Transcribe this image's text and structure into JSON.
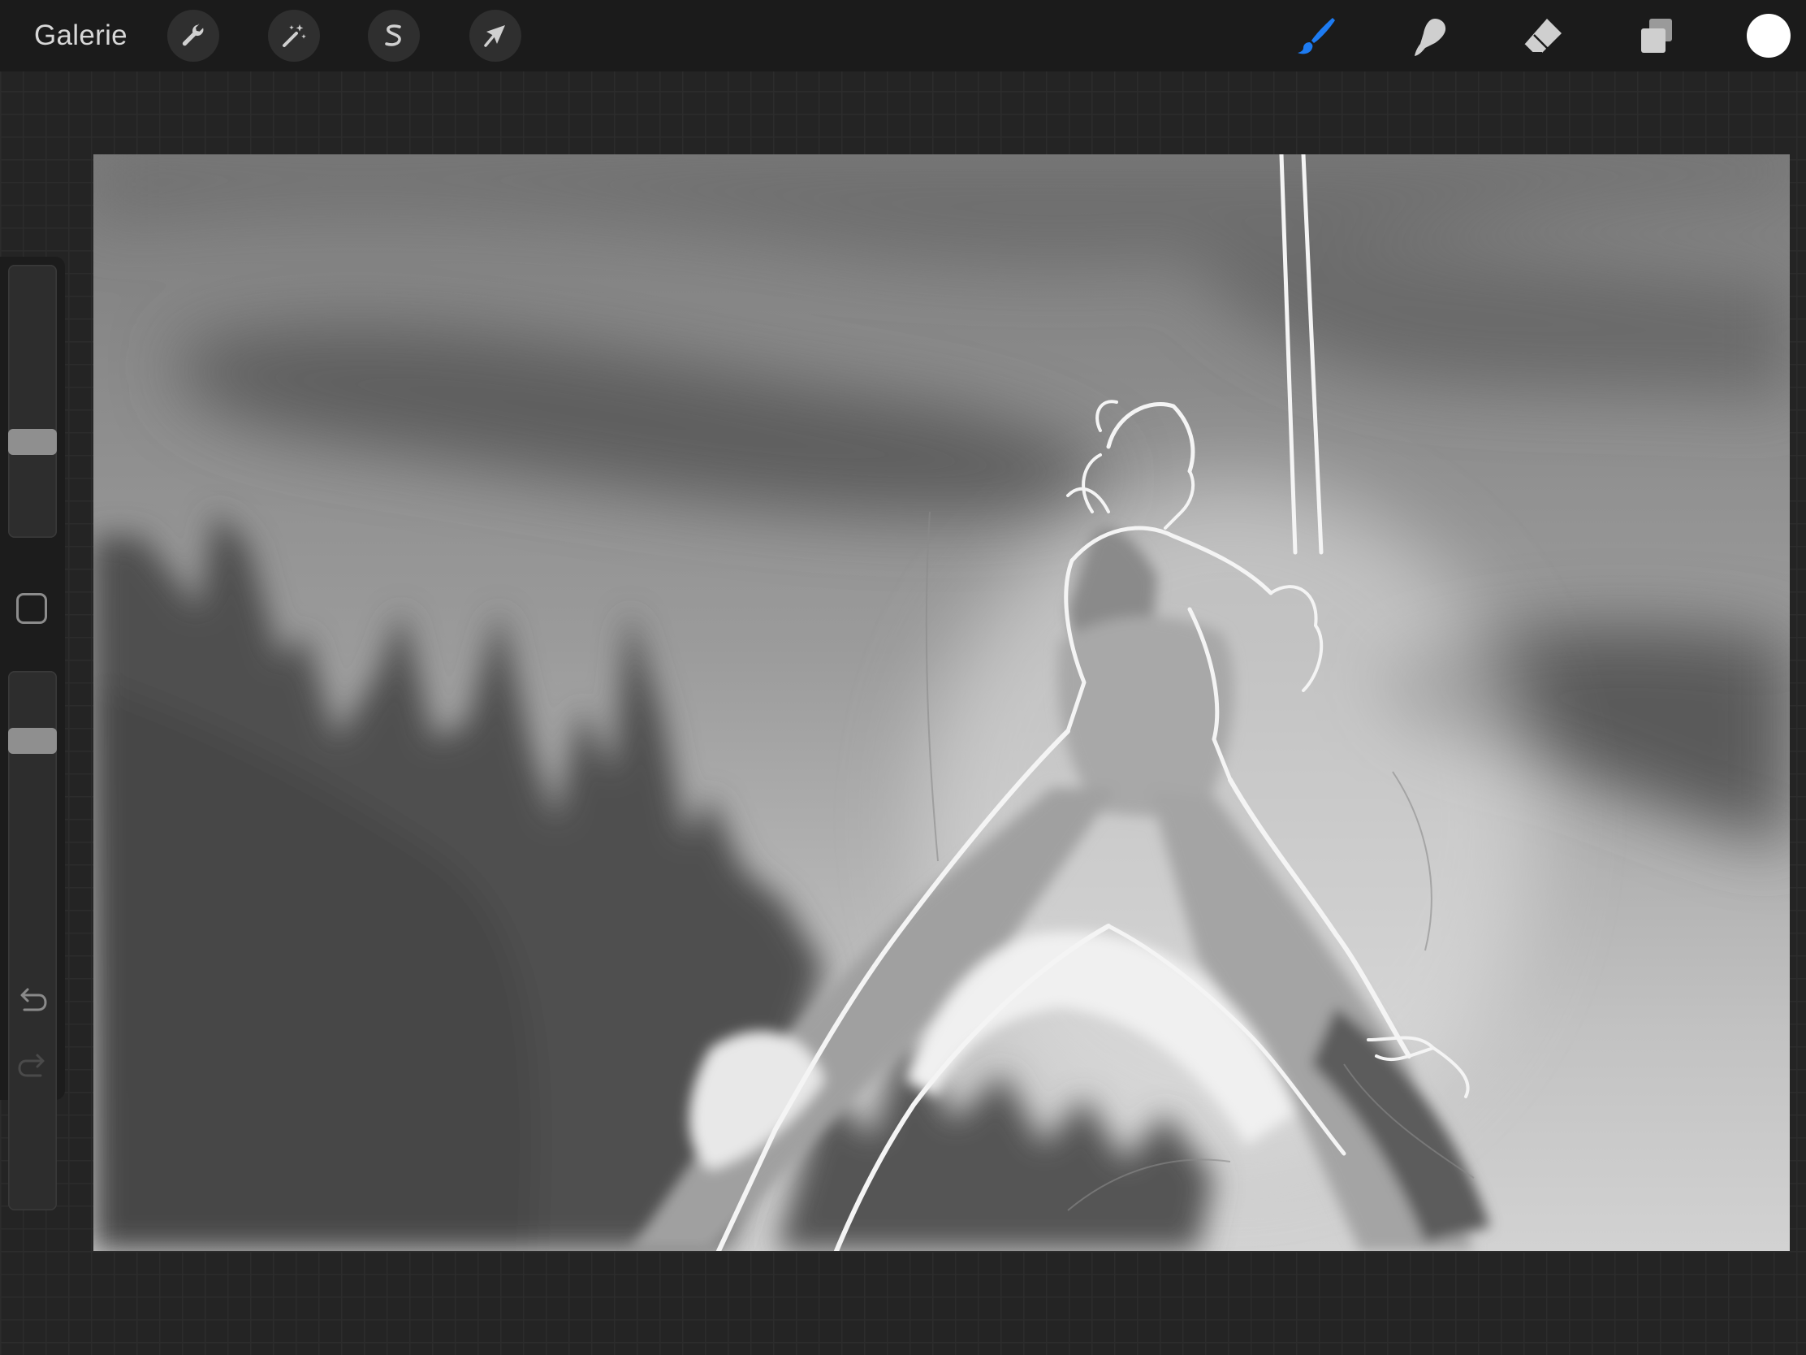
{
  "topbar": {
    "gallery_label": "Galerie",
    "left_tools": [
      {
        "name": "actions",
        "icon": "wrench-icon"
      },
      {
        "name": "adjustments",
        "icon": "magic-wand-icon"
      },
      {
        "name": "selection",
        "icon": "selection-s-icon"
      },
      {
        "name": "transform",
        "icon": "arrow-cursor-icon"
      }
    ],
    "right_tools": [
      {
        "name": "brush",
        "icon": "brush-icon",
        "active": true
      },
      {
        "name": "smudge",
        "icon": "smudge-finger-icon",
        "active": false
      },
      {
        "name": "eraser",
        "icon": "eraser-icon",
        "active": false
      },
      {
        "name": "layers",
        "icon": "layers-icon",
        "active": false
      }
    ],
    "current_color": "#ffffff"
  },
  "sidebar": {
    "brush_size_level": 0.27,
    "opacity_level": 0.11,
    "modify_button_icon": "rounded-square-icon",
    "undo_icon": "undo-arrow-icon",
    "redo_icon": "redo-arrow-icon"
  },
  "colors": {
    "accent_blue": "#1d7bf2",
    "toolbar_bg": "#1b1b1b",
    "icon_gray": "#cfcfcf"
  }
}
